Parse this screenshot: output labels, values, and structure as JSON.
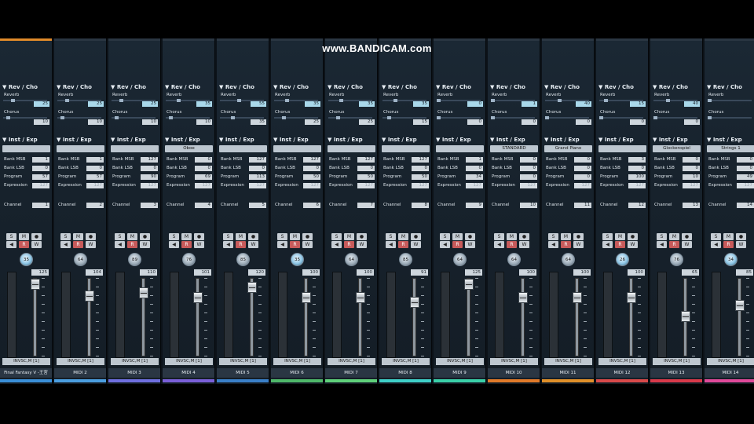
{
  "watermark": "www.BANDICAM.com",
  "labels": {
    "rev_cho": "Rev / Cho",
    "reverb": "Reverb",
    "chorus": "Chorus",
    "inst_exp": "Inst / Exp",
    "bank_msb": "Bank MSB",
    "bank_lsb": "Bank LSB",
    "program": "Program",
    "expression": "Expression",
    "channel": "Channel",
    "solo": "S",
    "mute": "M",
    "record": "●",
    "monitor": "◀",
    "read": "R",
    "write": "W",
    "collapse_glyph": "▼"
  },
  "channels": [
    {
      "name": "Final Fantasy V -王宮",
      "color": "#3a8fd8",
      "top_accent": "#e08a2a",
      "reverb": 25,
      "chorus": 10,
      "inst": "",
      "bank_msb": 1,
      "bank_lsb": 0,
      "program": 57,
      "expression": 127,
      "channel": 1,
      "pan": 35,
      "pan_blue": true,
      "volume": 125,
      "output": "INVSC,M [1]"
    },
    {
      "name": "MIDI 2",
      "color": "#4b9ee0",
      "top_accent": "",
      "reverb": 25,
      "chorus": 10,
      "inst": "",
      "bank_msb": 1,
      "bank_lsb": 0,
      "program": 57,
      "expression": 127,
      "channel": 2,
      "pan": 64,
      "pan_blue": false,
      "volume": 104,
      "output": "INVSC,M [1]"
    },
    {
      "name": "MIDI 3",
      "color": "#6f6fe0",
      "top_accent": "",
      "reverb": 25,
      "chorus": 10,
      "inst": "",
      "bank_msb": 127,
      "bank_lsb": 0,
      "program": 90,
      "expression": 127,
      "channel": 3,
      "pan": 89,
      "pan_blue": false,
      "volume": 110,
      "output": "INVSC,M [1]"
    },
    {
      "name": "MIDI 4",
      "color": "#7a5fd8",
      "top_accent": "",
      "reverb": 35,
      "chorus": 10,
      "inst": "Oboe",
      "bank_msb": 0,
      "bank_lsb": 0,
      "program": 69,
      "expression": 127,
      "channel": 4,
      "pan": 76,
      "pan_blue": false,
      "volume": 101,
      "output": "INVSC,M [1]"
    },
    {
      "name": "MIDI 5",
      "color": "#3a80c8",
      "top_accent": "",
      "reverb": 55,
      "chorus": 35,
      "inst": "",
      "bank_msb": 127,
      "bank_lsb": 0,
      "program": 113,
      "expression": 127,
      "channel": 5,
      "pan": 85,
      "pan_blue": false,
      "volume": 120,
      "output": "INVSC,M [1]"
    },
    {
      "name": "MIDI 6",
      "color": "#4fb86a",
      "top_accent": "",
      "reverb": 35,
      "chorus": 25,
      "inst": "",
      "bank_msb": 127,
      "bank_lsb": 0,
      "program": 50,
      "expression": 127,
      "channel": 6,
      "pan": 35,
      "pan_blue": true,
      "volume": 100,
      "output": "INVSC,M [1]"
    },
    {
      "name": "MIDI 7",
      "color": "#5fd07a",
      "top_accent": "",
      "reverb": 35,
      "chorus": 25,
      "inst": "",
      "bank_msb": 127,
      "bank_lsb": 0,
      "program": 50,
      "expression": 127,
      "channel": 7,
      "pan": 64,
      "pan_blue": false,
      "volume": 100,
      "output": "INVSC,M [1]"
    },
    {
      "name": "MIDI 8",
      "color": "#3fd0c8",
      "top_accent": "",
      "reverb": 35,
      "chorus": 15,
      "inst": "",
      "bank_msb": 127,
      "bank_lsb": 0,
      "program": 50,
      "expression": 127,
      "channel": 8,
      "pan": 85,
      "pan_blue": false,
      "volume": 91,
      "output": "INVSC,M [1]"
    },
    {
      "name": "MIDI 9",
      "color": "#3ad0a8",
      "top_accent": "",
      "reverb": 0,
      "chorus": 0,
      "inst": "",
      "bank_msb": 1,
      "bank_lsb": 0,
      "program": 34,
      "expression": 127,
      "channel": 9,
      "pan": 64,
      "pan_blue": false,
      "volume": 125,
      "output": "INVSC,M [1]"
    },
    {
      "name": "MIDI 10",
      "color": "#e07a2a",
      "top_accent": "",
      "reverb": 1,
      "chorus": 0,
      "inst": "STANDARD",
      "bank_msb": 0,
      "bank_lsb": 0,
      "program": 0,
      "expression": 127,
      "channel": 10,
      "pan": 64,
      "pan_blue": false,
      "volume": 100,
      "output": "INVSC,M [1]"
    },
    {
      "name": "MIDI 11",
      "color": "#e0902a",
      "top_accent": "",
      "reverb": 40,
      "chorus": 0,
      "inst": "Grand Piano",
      "bank_msb": 0,
      "bank_lsb": 0,
      "program": 0,
      "expression": 127,
      "channel": 11,
      "pan": 64,
      "pan_blue": false,
      "volume": 100,
      "output": "INVSC,M [1]"
    },
    {
      "name": "MIDI 12",
      "color": "#d84a4a",
      "top_accent": "",
      "reverb": 15,
      "chorus": 0,
      "inst": "",
      "bank_msb": 3,
      "bank_lsb": 0,
      "program": 100,
      "expression": 127,
      "channel": 12,
      "pan": 26,
      "pan_blue": true,
      "volume": 100,
      "output": "INVSC,M [1]"
    },
    {
      "name": "MIDI 13",
      "color": "#d83a4a",
      "top_accent": "",
      "reverb": 40,
      "chorus": 0,
      "inst": "Glockenspiel",
      "bank_msb": 0,
      "bank_lsb": 0,
      "program": 10,
      "expression": 127,
      "channel": 13,
      "pan": 76,
      "pan_blue": false,
      "volume": 65,
      "output": "INVSC,M [1]"
    },
    {
      "name": "MIDI 14",
      "color": "#e04a9a",
      "top_accent": "",
      "reverb": "",
      "chorus": "",
      "inst": "Strings 1",
      "bank_msb": 0,
      "bank_lsb": 0,
      "program": 49,
      "expression": 127,
      "channel": 14,
      "pan": 34,
      "pan_blue": true,
      "volume": 85,
      "output": "INVSC,M [1]"
    }
  ]
}
